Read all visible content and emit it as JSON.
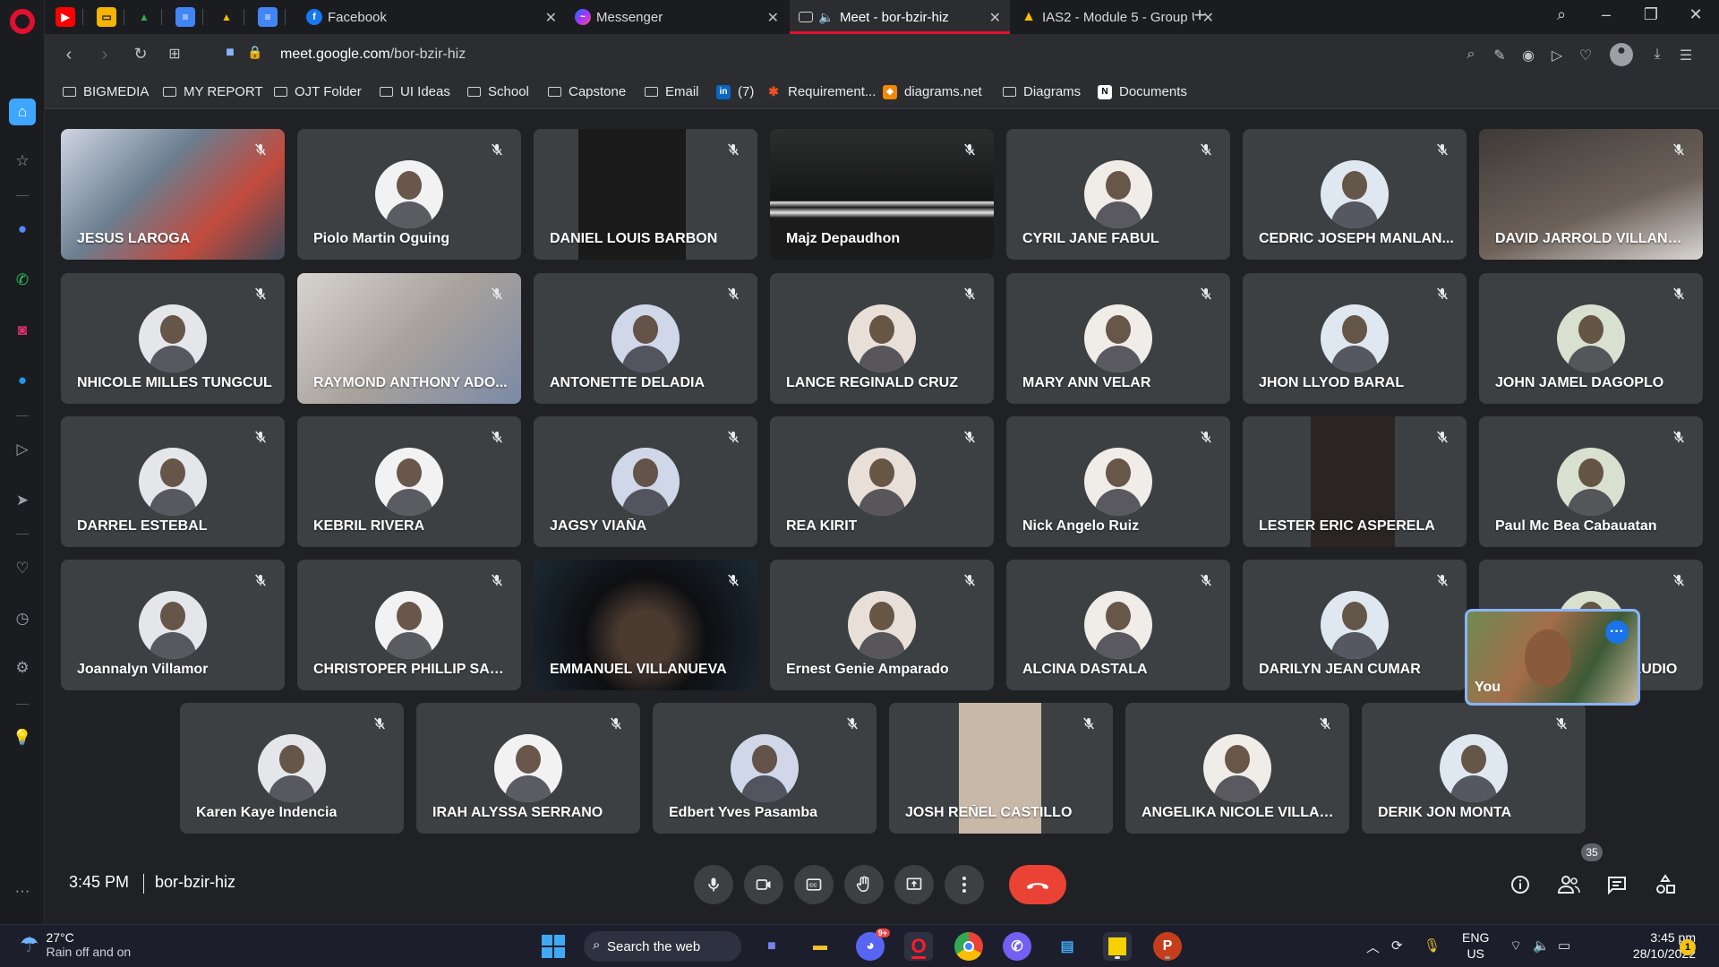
{
  "tabs": [
    {
      "label": "Facebook"
    },
    {
      "label": "Messenger"
    },
    {
      "label": "Meet - bor-bzir-hiz"
    },
    {
      "label": "IAS2 - Module 5 - Group U"
    }
  ],
  "address_bar": {
    "url_host": "meet.google.com",
    "url_path": "/bor-bzir-hiz"
  },
  "bookmarks": [
    {
      "label": "BIGMEDIA"
    },
    {
      "label": "MY REPORT"
    },
    {
      "label": "OJT Folder"
    },
    {
      "label": "UI Ideas"
    },
    {
      "label": "School"
    },
    {
      "label": "Capstone"
    },
    {
      "label": "Email"
    },
    {
      "label": "(7)"
    },
    {
      "label": "Requirement..."
    },
    {
      "label": "diagrams.net"
    },
    {
      "label": "Diagrams"
    },
    {
      "label": "Documents"
    }
  ],
  "participants": [
    {
      "name": "JESUS LAROGA"
    },
    {
      "name": "Piolo Martin Oguing"
    },
    {
      "name": "DANIEL LOUIS BARBON"
    },
    {
      "name": "Majz Depaudhon"
    },
    {
      "name": "CYRIL JANE FABUL"
    },
    {
      "name": "CEDRIC JOSEPH MANLAN..."
    },
    {
      "name": "DAVID JARROLD VILLANUE..."
    },
    {
      "name": "NHICOLE MILLES TUNGCUL"
    },
    {
      "name": "RAYMOND ANTHONY ADO..."
    },
    {
      "name": "ANTONETTE DELADIA"
    },
    {
      "name": "LANCE REGINALD CRUZ"
    },
    {
      "name": "MARY ANN VELAR"
    },
    {
      "name": "JHON LLYOD BARAL"
    },
    {
      "name": "JOHN JAMEL DAGOPLO"
    },
    {
      "name": "DARREL ESTEBAL"
    },
    {
      "name": "KEBRIL RIVERA"
    },
    {
      "name": "JAGSY VIAÑA"
    },
    {
      "name": "REA KIRIT"
    },
    {
      "name": "Nick Angelo Ruiz"
    },
    {
      "name": "LESTER ERIC ASPERELA"
    },
    {
      "name": "Paul Mc Bea Cabauatan"
    },
    {
      "name": "Joannalyn Villamor"
    },
    {
      "name": "CHRISTOPER PHILLIP SALA..."
    },
    {
      "name": "EMMANUEL VILLANUEVA"
    },
    {
      "name": "Ernest Genie Amparado"
    },
    {
      "name": "ALCINA DASTALA"
    },
    {
      "name": "DARILYN JEAN CUMAR"
    },
    {
      "name": "APRIL GEM LEO CLAUDIO"
    },
    {
      "name": "Karen Kaye Indencia"
    },
    {
      "name": "IRAH ALYSSA SERRANO"
    },
    {
      "name": "Edbert Yves Pasamba"
    },
    {
      "name": "JOSH REÑEL CASTILLO"
    },
    {
      "name": "ANGELIKA NICOLE VILLAM..."
    },
    {
      "name": "DERIK JON MONTA"
    }
  ],
  "self_view": {
    "label": "You"
  },
  "meeting": {
    "time": "3:45 PM",
    "code": "bor-bzir-hiz",
    "participant_count": "35"
  },
  "taskbar": {
    "weather_temp": "27°C",
    "weather_condition": "Rain off and on",
    "search_placeholder": "Search the web",
    "discord_badge": "9+",
    "lang_line1": "ENG",
    "lang_line2": "US",
    "time": "3:45 pm",
    "date": "28/10/2022",
    "notification_count": "1"
  },
  "colors": {
    "end_call": "#ea4335",
    "active_tab_accent": "#e0102e",
    "self_view_border": "#8ab4f8"
  }
}
